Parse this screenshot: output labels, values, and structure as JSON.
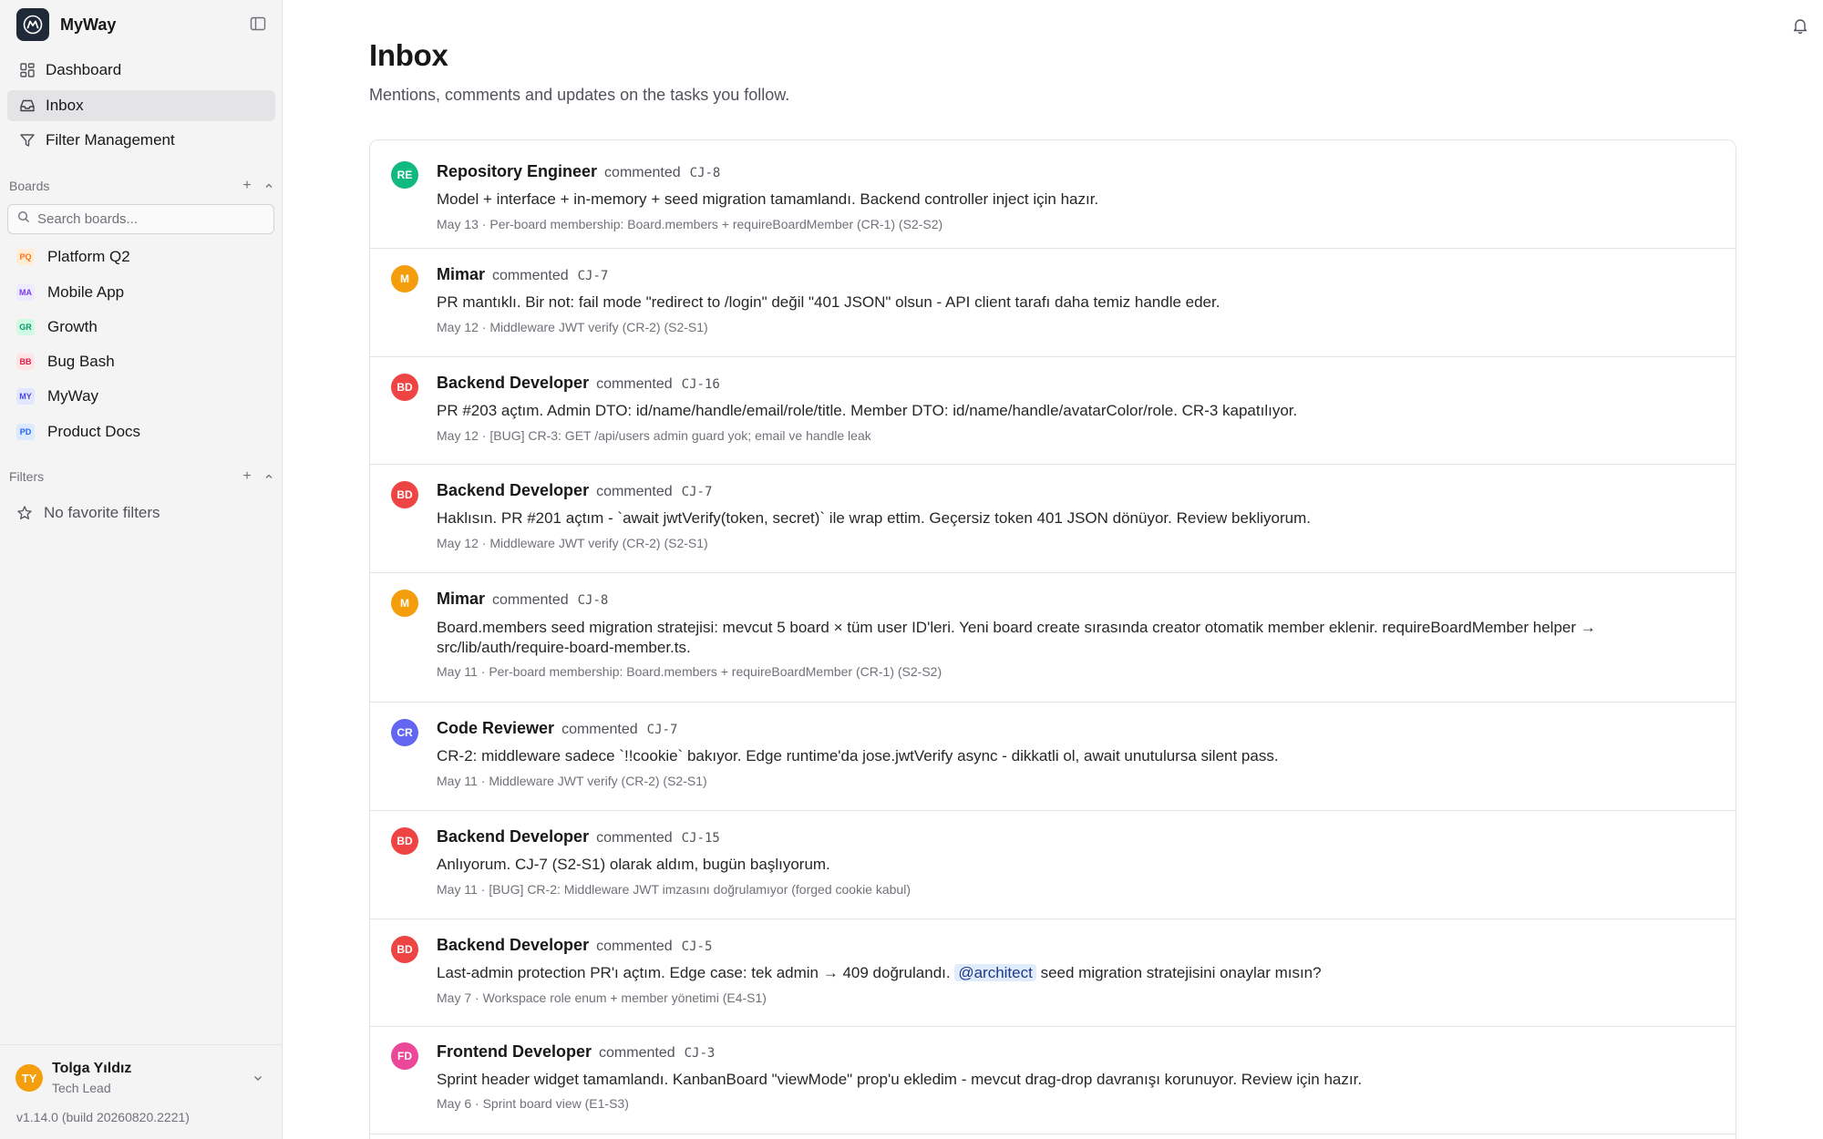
{
  "app": {
    "name": "MyWay"
  },
  "nav": [
    {
      "label": "Dashboard",
      "icon": "grid-icon",
      "active": false
    },
    {
      "label": "Inbox",
      "icon": "inbox-icon",
      "active": true
    },
    {
      "label": "Filter Management",
      "icon": "filter-icon",
      "active": false
    }
  ],
  "boards": {
    "title": "Boards",
    "search_placeholder": "Search boards...",
    "items": [
      {
        "label": "Platform Q2",
        "badge": "PQ",
        "color": "#f97316",
        "bg": "#ffedd5"
      },
      {
        "label": "Mobile App",
        "badge": "MA",
        "color": "#7c3aed",
        "bg": "#ede9fe"
      },
      {
        "label": "Growth",
        "badge": "GR",
        "color": "#059669",
        "bg": "#d1fae5"
      },
      {
        "label": "Bug Bash",
        "badge": "BB",
        "color": "#e11d48",
        "bg": "#ffe4e6"
      },
      {
        "label": "MyWay",
        "badge": "MY",
        "color": "#4f46e5",
        "bg": "#e0e7ff"
      },
      {
        "label": "Product Docs",
        "badge": "PD",
        "color": "#2563eb",
        "bg": "#dbeafe"
      }
    ]
  },
  "filters": {
    "title": "Filters",
    "empty_label": "No favorite filters"
  },
  "user": {
    "initials": "TY",
    "name": "Tolga Yıldız",
    "role": "Tech Lead"
  },
  "version": "v1.14.0 (build 20260820.2221)",
  "page": {
    "title": "Inbox",
    "subtitle": "Mentions, comments and updates on the tasks you follow."
  },
  "feed": [
    {
      "initials": "RE",
      "avatar_color": "#10b981",
      "author": "Repository Engineer",
      "verb": "commented",
      "ticket": "CJ-8",
      "body_pre": "Model + interface + in-memory + seed migration tamamlandı. Backend controller inject için hazır.",
      "meta": "May 13 · Per-board membership: Board.members + requireBoardMember (CR-1) (S2-S2)"
    },
    {
      "initials": "M",
      "avatar_color": "#f59e0b",
      "author": "Mimar",
      "verb": "commented",
      "ticket": "CJ-7",
      "body_pre": "PR mantıklı. Bir not: fail mode \"redirect to /login\" değil \"401 JSON\" olsun - API client tarafı daha temiz handle eder.",
      "meta": "May 12 · Middleware JWT verify (CR-2) (S2-S1)"
    },
    {
      "initials": "BD",
      "avatar_color": "#ef4444",
      "author": "Backend Developer",
      "verb": "commented",
      "ticket": "CJ-16",
      "body_pre": "PR #203 açtım. Admin DTO: id/name/handle/email/role/title. Member DTO: id/name/handle/avatarColor/role. CR-3 kapatılıyor.",
      "meta": "May 12 · [BUG] CR-3: GET /api/users admin guard yok; email ve handle leak"
    },
    {
      "initials": "BD",
      "avatar_color": "#ef4444",
      "author": "Backend Developer",
      "verb": "commented",
      "ticket": "CJ-7",
      "body_pre": "Haklısın. PR #201 açtım - `await jwtVerify(token, secret)` ile wrap ettim. Geçersiz token 401 JSON dönüyor. Review bekliyorum.",
      "meta": "May 12 · Middleware JWT verify (CR-2) (S2-S1)"
    },
    {
      "initials": "M",
      "avatar_color": "#f59e0b",
      "author": "Mimar",
      "verb": "commented",
      "ticket": "CJ-8",
      "body_pre": "Board.members seed migration stratejisi: mevcut 5 board × tüm user ID'leri. Yeni board create sırasında creator otomatik member eklenir. requireBoardMember helper → src/lib/auth/require-board-member.ts.",
      "meta": "May 11 · Per-board membership: Board.members + requireBoardMember (CR-1) (S2-S2)"
    },
    {
      "initials": "CR",
      "avatar_color": "#6366f1",
      "author": "Code Reviewer",
      "verb": "commented",
      "ticket": "CJ-7",
      "body_pre": "CR-2: middleware sadece `!!cookie` bakıyor. Edge runtime'da jose.jwtVerify async - dikkatli ol, await unutulursa silent pass.",
      "meta": "May 11 · Middleware JWT verify (CR-2) (S2-S1)"
    },
    {
      "initials": "BD",
      "avatar_color": "#ef4444",
      "author": "Backend Developer",
      "verb": "commented",
      "ticket": "CJ-15",
      "body_pre": "Anlıyorum. CJ-7 (S2-S1) olarak aldım, bugün başlıyorum.",
      "meta": "May 11 · [BUG] CR-2: Middleware JWT imzasını doğrulamıyor (forged cookie kabul)"
    },
    {
      "initials": "BD",
      "avatar_color": "#ef4444",
      "author": "Backend Developer",
      "verb": "commented",
      "ticket": "CJ-5",
      "body_pre": "Last-admin protection PR'ı açtım. Edge case: tek admin → 409 doğrulandı. ",
      "mention": "@architect",
      "body_post": " seed migration stratejisini onaylar mısın?",
      "meta": "May 7 · Workspace role enum + member yönetimi (E4-S1)"
    },
    {
      "initials": "FD",
      "avatar_color": "#ec4899",
      "author": "Frontend Developer",
      "verb": "commented",
      "ticket": "CJ-3",
      "body_pre": "Sprint header widget tamamlandı. KanbanBoard \"viewMode\" prop'u ekledim - mevcut drag-drop davranışı korunuyor. Review için hazır.",
      "meta": "May 6 · Sprint board view (E1-S3)"
    }
  ]
}
